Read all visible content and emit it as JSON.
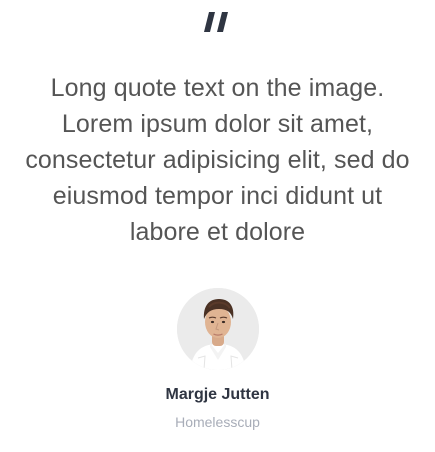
{
  "testimonial": {
    "icon": "quote-icon",
    "quote_lines": [
      "Long quote text on the image.",
      "Lorem ipsum dolor sit amet,",
      "consectetur adipisicing elit, sed do",
      "eiusmod tempor inci didunt ut",
      "labore et dolore"
    ],
    "author": {
      "name": "Margje Jutten",
      "company": "Homelesscup",
      "avatar_icon": "person-avatar"
    }
  },
  "colors": {
    "quote_icon": "#2f3542",
    "quote_text": "#555555",
    "author_name": "#2f3542",
    "author_company": "#a8adb8"
  }
}
